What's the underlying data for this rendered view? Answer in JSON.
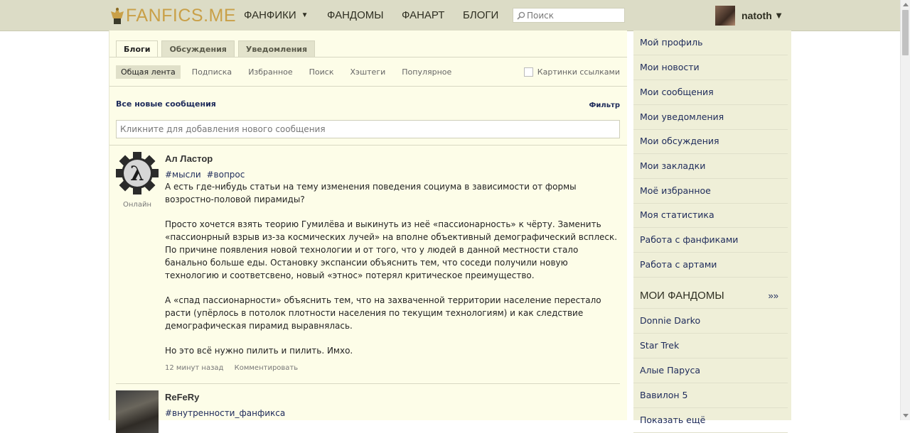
{
  "header": {
    "logo_text": "FANFICS.ME",
    "nav": [
      {
        "label": "ФАНФИКИ"
      },
      {
        "label": "ФАНДОМЫ"
      },
      {
        "label": "ФАНАРТ"
      },
      {
        "label": "БЛОГИ"
      }
    ],
    "search_placeholder": "Поиск",
    "username": "natoth"
  },
  "tabs": [
    "Блоги",
    "Обсуждения",
    "Уведомления"
  ],
  "subnav": [
    "Общая лента",
    "Подписка",
    "Избранное",
    "Поиск",
    "Хэштеги",
    "Популярное"
  ],
  "link_pictures_label": "Картинки ссылками",
  "feed": {
    "title": "Все новые сообщения",
    "filter_label": "Фильтр",
    "composer_placeholder": "Кликните для добавления нового сообщения"
  },
  "posts": [
    {
      "author": "Ал Ластор",
      "online": "Онлайн",
      "tags": [
        "#мысли",
        "#вопрос"
      ],
      "paragraphs": [
        "А есть где-нибудь статьи на тему изменения поведения социума в зависимости от формы возростно-половой пирамиды?",
        "Просто хочется взять теорию Гумилёва и выкинуть из неё «пассионарность» к чёрту. Заменить «пассионрный взрыв из-за космических лучей» на вполне объективный демографический всплеск. По причине появления новой технологии и от того, что у людей в данной местности стало банально больше еды. Остановку экспансии объяснить тем, что соседи получили новую технологию и соответсвено, новый «этнос» потерял критическое преимущество.",
        "А «спад пассионарности» объяснить тем, что на захваченной территории население перестало расти (упёрлось в потолок плотности населения по текущим технологиям) и как следствие демографическая пирамид выравнялась.",
        "Но это всё нужно пилить и пилить. Имхо."
      ],
      "time": "12 минут назад",
      "comment_label": "Комментировать"
    },
    {
      "author": "ReFeRy",
      "tags": [
        "#внутренности_фанфикса"
      ]
    }
  ],
  "sidebar": {
    "items": [
      "Мой профиль",
      "Мои новости",
      "Мои сообщения",
      "Мои уведомления",
      "Мои обсуждения",
      "Мои закладки",
      "Моё избранное",
      "Моя статистика",
      "Работа с фанфиками",
      "Работа с артами"
    ],
    "fandoms_title": "МОИ ФАНДОМЫ",
    "fandoms_more": "»»",
    "fandoms": [
      "Donnie Darko",
      "Star Trek",
      "Алые Паруса",
      "Вавилон 5",
      "Показать ещё"
    ]
  },
  "colors": {
    "topbar": "#dcdcc6",
    "main_bg": "#fdfde8",
    "sidebar_bg": "#efefd8",
    "link": "#1d2a5a",
    "logo": "#c9a048"
  }
}
